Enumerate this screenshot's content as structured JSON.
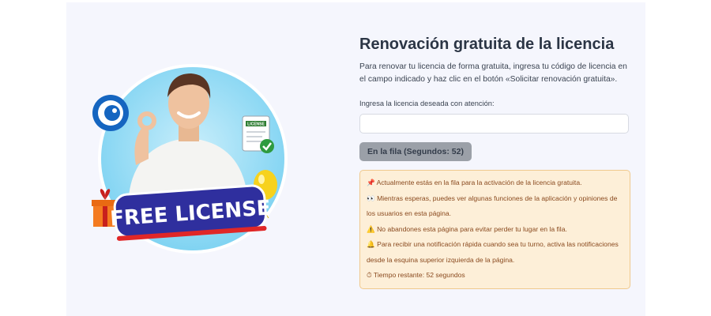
{
  "hero": {
    "badge_text": "FREE LICENSE",
    "document_label": "LICENSE"
  },
  "main": {
    "title": "Renovación gratuita de la licencia",
    "description": "Para renovar tu licencia de forma gratuita, ingresa tu código de licencia en el campo indicado y haz clic en el botón «Solicitar renovación gratuita».",
    "license_field": {
      "label": "Ingresa la licencia deseada con atención:",
      "value": "",
      "placeholder": ""
    },
    "queue_button": {
      "label": "En la fila (Segundos: 52)"
    },
    "notice": {
      "lines": [
        {
          "icon": "pushpin-icon",
          "text": "📌 Actualmente estás en la fila para la activación de la licencia gratuita."
        },
        {
          "icon": "eyes-icon",
          "text": "👀 Mientras esperas, puedes ver algunas funciones de la aplicación y opiniones de los usuarios en esta página."
        },
        {
          "icon": "warning-icon",
          "text": "⚠️ No abandones esta página para evitar perder tu lugar en la fila."
        },
        {
          "icon": "bell-icon",
          "text": "🔔 Para recibir una notificación rápida cuando sea tu turno, activa las notificaciones desde la esquina superior izquierda de la página."
        },
        {
          "icon": "stopwatch-icon",
          "text": "⏱ Tiempo restante: 52 segundos"
        }
      ]
    }
  },
  "colors": {
    "page_background": "#f5f6fd",
    "notice_background": "#fdefd8",
    "notice_border": "#f0c98d",
    "button_background": "#9ba0a8",
    "badge_blue": "#2f2f9e"
  }
}
